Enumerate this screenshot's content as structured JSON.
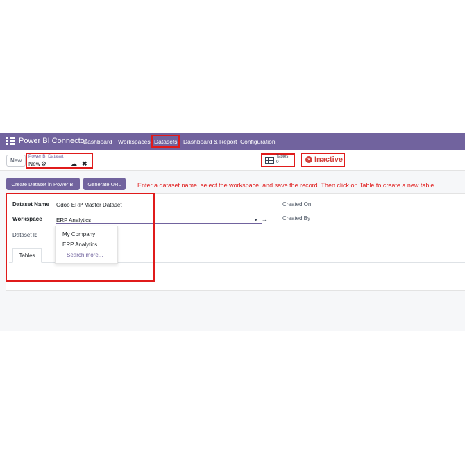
{
  "navbar": {
    "app_name": "Power BI Connector",
    "items": [
      "Dashboard",
      "Workspaces",
      "Datasets",
      "Dashboard & Report",
      "Configuration"
    ],
    "active_item": "Datasets",
    "color": "#71639e"
  },
  "control": {
    "new_label": "New",
    "breadcrumb_parent": "Power BI Dataset",
    "breadcrumb_current": "New",
    "icons": [
      "gear-icon",
      "cloud-upload-icon",
      "close-icon"
    ],
    "tables_label": "Tables",
    "tables_count": "0",
    "status_label": "Inactive",
    "status_color": "#d23f3a"
  },
  "actions": {
    "create_label": "Create Dataset in Power BI",
    "generate_label": "Generate URL",
    "instruction": "Enter a dataset name, select the workspace, and save the record. Then click on Table to create a new table"
  },
  "form": {
    "dataset_name_label": "Dataset Name",
    "dataset_name_value": "Odoo ERP Master Dataset",
    "workspace_label": "Workspace",
    "workspace_value": "ERP Analytics",
    "dataset_id_label": "Dataset Id",
    "created_on_label": "Created On",
    "created_by_label": "Created By",
    "dropdown_options": [
      "My Company",
      "ERP Analytics"
    ],
    "dropdown_search": "Search more...",
    "tab_label": "Tables"
  }
}
